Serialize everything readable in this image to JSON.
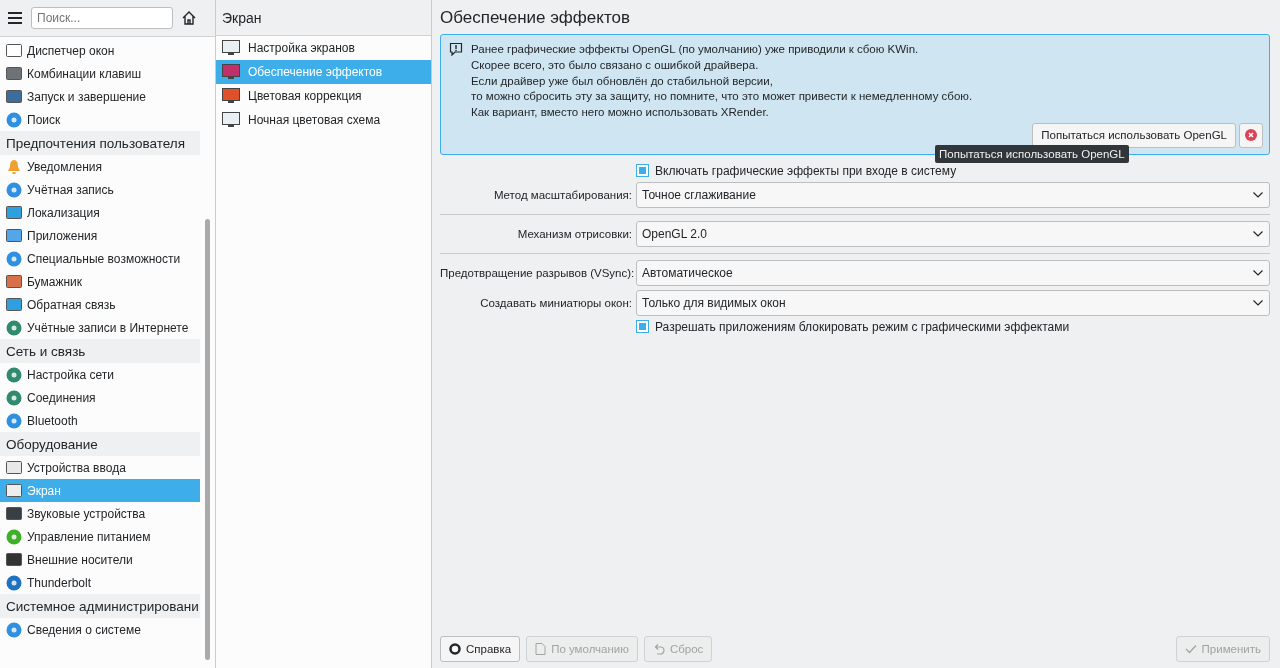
{
  "sidebar": {
    "search": {
      "placeholder": "Поиск..."
    },
    "items": [
      {
        "label": "Диспетчер окон",
        "selected": false
      },
      {
        "label": "Комбинации клавиш",
        "selected": false
      },
      {
        "label": "Запуск и завершение",
        "selected": false
      },
      {
        "label": "Поиск",
        "selected": false
      }
    ],
    "sections": [
      {
        "title": "Предпочтения пользователя",
        "items": [
          {
            "label": "Уведомления",
            "selected": false
          },
          {
            "label": "Учётная запись",
            "selected": false
          },
          {
            "label": "Локализация",
            "selected": false
          },
          {
            "label": "Приложения",
            "selected": false
          },
          {
            "label": "Специальные возможности",
            "selected": false
          },
          {
            "label": "Бумажник",
            "selected": false
          },
          {
            "label": "Обратная связь",
            "selected": false
          },
          {
            "label": "Учётные записи в Интернете",
            "selected": false
          }
        ]
      },
      {
        "title": "Сеть и связь",
        "items": [
          {
            "label": "Настройка сети",
            "selected": false
          },
          {
            "label": "Соединения",
            "selected": false
          },
          {
            "label": "Bluetooth",
            "selected": false
          }
        ]
      },
      {
        "title": "Оборудование",
        "items": [
          {
            "label": "Устройства ввода",
            "selected": false
          },
          {
            "label": "Экран",
            "selected": true
          },
          {
            "label": "Звуковые устройства",
            "selected": false
          },
          {
            "label": "Управление питанием",
            "selected": false
          },
          {
            "label": "Внешние носители",
            "selected": false
          },
          {
            "label": "Thunderbolt",
            "selected": false
          }
        ]
      },
      {
        "title": "Системное администрировани",
        "items": [
          {
            "label": "Сведения о системе",
            "selected": false
          }
        ]
      }
    ]
  },
  "subpanel": {
    "title": "Экран",
    "items": [
      {
        "label": "Настройка экранов",
        "selected": false
      },
      {
        "label": "Обеспечение эффектов",
        "selected": true
      },
      {
        "label": "Цветовая коррекция",
        "selected": false
      },
      {
        "label": "Ночная цветовая схема",
        "selected": false
      }
    ]
  },
  "main": {
    "title": "Обеспечение эффектов",
    "alert": {
      "lines": [
        "Ранее графические эффекты OpenGL (по умолчанию) уже приводили к сбою KWin.",
        "Скорее всего, это было связано с ошибкой драйвера.",
        "Если драйвер уже был обновлён до стабильной версии,",
        "то можно сбросить эту за защиту, но помните, что это может привести к немедленному сбою.",
        "Как вариант, вместо него можно использовать XRender."
      ],
      "button": "Попытаться использовать OpenGL"
    },
    "tooltip": "Попытаться использовать OpenGL",
    "options": [
      {
        "kind": "checkbox",
        "label": "Включать графические эффекты при входе в систему",
        "checked": true
      },
      {
        "kind": "combo",
        "label": "Метод масштабирования:",
        "value": "Точное сглаживание"
      },
      {
        "kind": "separator"
      },
      {
        "kind": "combo",
        "label": "Механизм отрисовки:",
        "value": "OpenGL 2.0"
      },
      {
        "kind": "separator"
      },
      {
        "kind": "combo",
        "label": "Предотвращение разрывов (VSync):",
        "value": "Автоматическое"
      },
      {
        "kind": "combo",
        "label": "Создавать миниатюры окон:",
        "value": "Только для видимых окон"
      },
      {
        "kind": "checkbox",
        "label": "Разрешать приложениям блокировать режим с графическими эффектами",
        "checked": true
      }
    ]
  },
  "footer": {
    "buttons": [
      {
        "kind": "help",
        "label": "Справка",
        "disabled": false
      },
      {
        "kind": "defaults",
        "label": "По умолчанию",
        "disabled": true
      },
      {
        "kind": "reset",
        "label": "Сброс",
        "disabled": true
      }
    ],
    "apply": {
      "label": "Применить",
      "disabled": true
    }
  }
}
